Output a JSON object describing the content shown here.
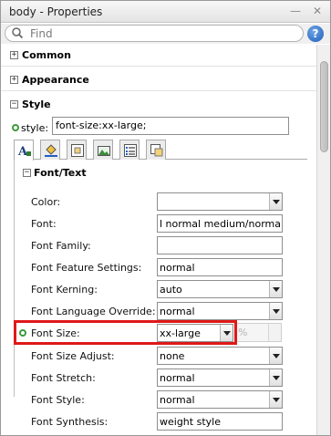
{
  "window": {
    "title": "body - Properties",
    "minimize_glyph": "—",
    "close_glyph": "✕"
  },
  "search": {
    "placeholder": "Find",
    "help_glyph": "?"
  },
  "sections": {
    "common": "Common",
    "appearance": "Appearance",
    "style": "Style",
    "font_text": "Font/Text"
  },
  "style_attr": {
    "label": "style:",
    "value": "font-size:xx-large;"
  },
  "tabs": [
    {
      "icon": "font-text-icon",
      "active": true
    },
    {
      "icon": "background-paint-icon",
      "active": false
    },
    {
      "icon": "box-model-icon",
      "active": false
    },
    {
      "icon": "border-image-icon",
      "active": false
    },
    {
      "icon": "list-icon",
      "active": false
    },
    {
      "icon": "positioning-icon",
      "active": false
    }
  ],
  "properties": [
    {
      "label": "Color:",
      "value": "",
      "type": "combo"
    },
    {
      "label": "Font:",
      "value": "l normal medium/normal",
      "type": "text"
    },
    {
      "label": "Font Family:",
      "value": "",
      "type": "text"
    },
    {
      "label": "Font Feature Settings:",
      "value": "normal",
      "type": "text"
    },
    {
      "label": "Font Kerning:",
      "value": "auto",
      "type": "combo"
    },
    {
      "label": "Font Language Override:",
      "value": "normal",
      "type": "combo"
    },
    {
      "label": "Font Size:",
      "value": "xx-large",
      "type": "combo",
      "set": true,
      "unit": "%"
    },
    {
      "label": "Font Size Adjust:",
      "value": "none",
      "type": "combo"
    },
    {
      "label": "Font Stretch:",
      "value": "normal",
      "type": "combo"
    },
    {
      "label": "Font Style:",
      "value": "normal",
      "type": "combo"
    },
    {
      "label": "Font Synthesis:",
      "value": "weight style",
      "type": "text"
    }
  ],
  "colors": {
    "set_indicator": "#3c9a3c",
    "highlight": "#e01818",
    "help_blue": "#1f5db8"
  }
}
